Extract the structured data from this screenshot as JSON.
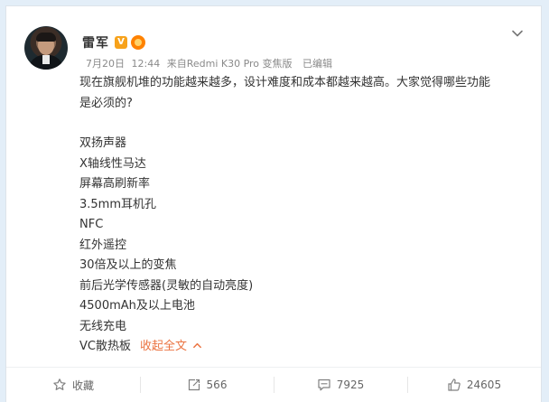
{
  "post": {
    "author": "雷军",
    "verified_badge": "V",
    "meta": {
      "date": "7月20日",
      "time": "12:44",
      "source_prefix": "来自",
      "source": "Redmi K30 Pro 变焦版",
      "edited": "已编辑"
    },
    "intro_line1": "现在旗舰机堆的功能越来越多，设计难度和成本都越来越高。大家觉得哪些功能",
    "intro_line2": "是必须的?",
    "features": [
      "双扬声器",
      "X轴线性马达",
      "屏幕高刷新率",
      "3.5mm耳机孔",
      "NFC",
      "红外遥控",
      "30倍及以上的变焦",
      "前后光学传感器(灵敏的自动亮度)",
      "4500mAh及以上电池",
      "无线充电",
      "VC散热板"
    ],
    "collapse_label": "收起全文",
    "collapse_icon": "chevron-up-icon"
  },
  "actions": {
    "favorite": "收藏",
    "repost": "566",
    "comment": "7925",
    "like": "24605"
  },
  "colors": {
    "background": "#e3eef8",
    "accent": "#eb7340",
    "verified": "#f7a21b"
  }
}
